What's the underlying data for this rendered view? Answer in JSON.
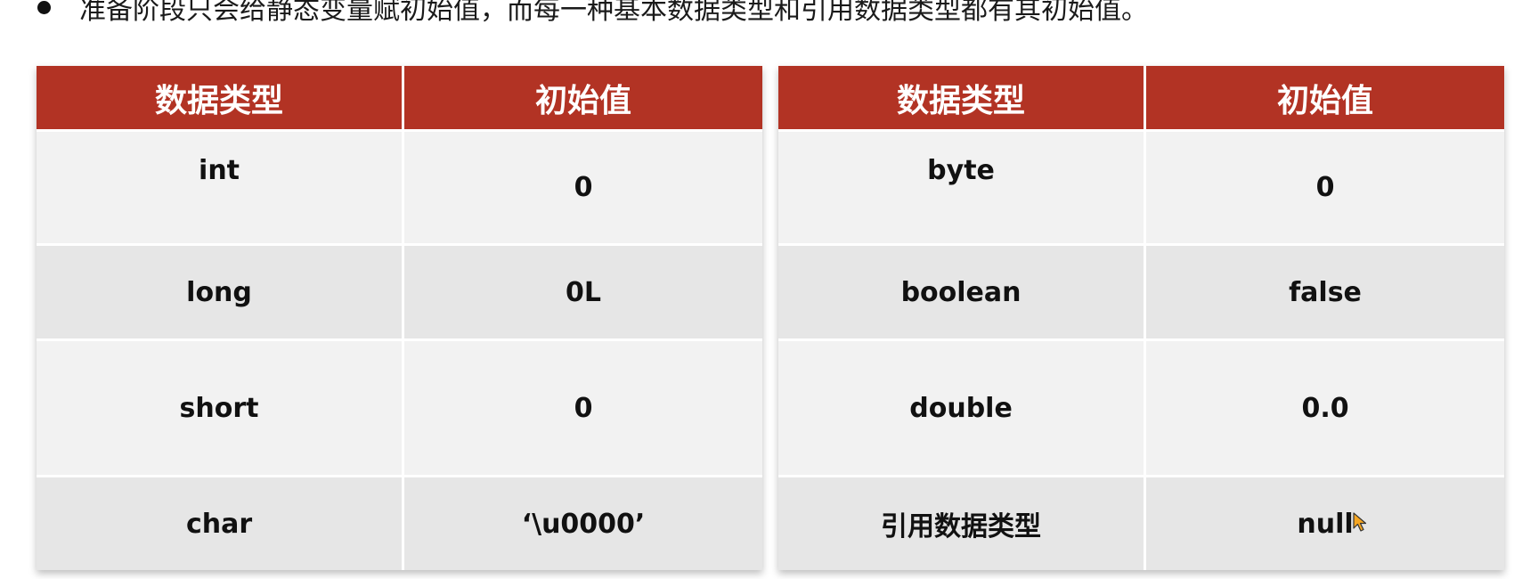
{
  "intro": {
    "text": "准备阶段只会给静态变量赋初始值，而每一种基本数据类型和引用数据类型都有其初始值。"
  },
  "colors": {
    "header_bg": "#b23324",
    "row_light": "#f2f2f2",
    "row_dark": "#e6e6e6",
    "cursor": "#f5a623"
  },
  "left_table": {
    "headers": [
      "数据类型",
      "初始值"
    ],
    "rows": [
      [
        "int",
        "0"
      ],
      [
        "long",
        "0L"
      ],
      [
        "short",
        "0"
      ],
      [
        "char",
        "‘\\u0000’"
      ]
    ]
  },
  "right_table": {
    "headers": [
      "数据类型",
      "初始值"
    ],
    "rows": [
      [
        "byte",
        "0"
      ],
      [
        "boolean",
        "false"
      ],
      [
        "double",
        "0.0"
      ],
      [
        "引用数据类型",
        "null"
      ]
    ]
  },
  "cursor_icon": "mouse-pointer-icon"
}
